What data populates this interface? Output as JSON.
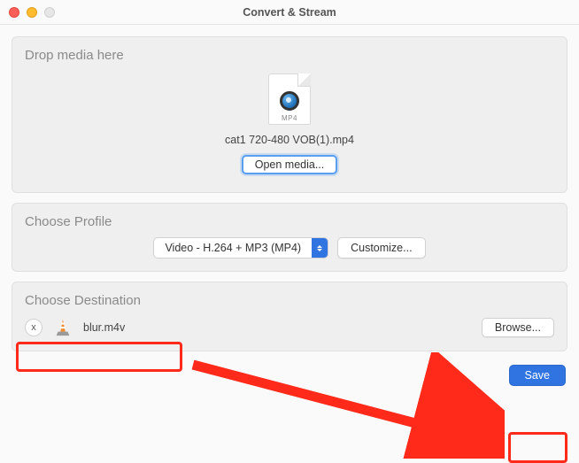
{
  "window": {
    "title": "Convert & Stream"
  },
  "drop": {
    "label": "Drop media here",
    "file_ext": "MP4",
    "filename": "cat1 720-480 VOB(1).mp4",
    "open_media": "Open media..."
  },
  "profile": {
    "label": "Choose Profile",
    "selected": "Video - H.264 + MP3 (MP4)",
    "customize": "Customize..."
  },
  "destination": {
    "label": "Choose Destination",
    "file": "blur.m4v",
    "browse": "Browse...",
    "x": "x"
  },
  "actions": {
    "save": "Save"
  },
  "icons": {
    "vlc": "vlc-icon",
    "quicktime": "quicktime-icon"
  }
}
